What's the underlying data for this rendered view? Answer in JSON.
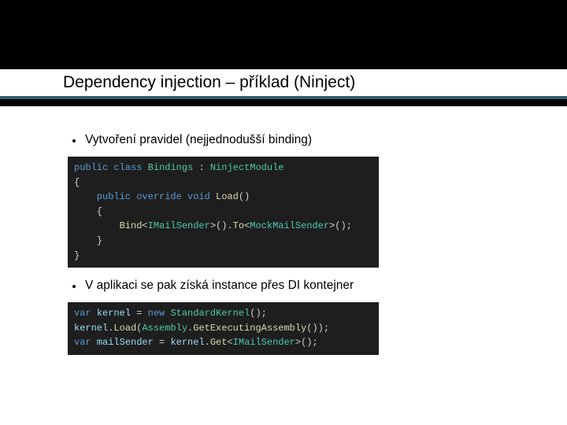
{
  "slide": {
    "title": "Dependency injection – příklad (Ninject)",
    "bullets": [
      {
        "text": "Vytvoření pravidel (nejjednodušší binding)"
      },
      {
        "text": "V aplikaci se pak získá instance přes DI kontejner"
      }
    ]
  },
  "code1": {
    "l1_public": "public",
    "l1_class": "class",
    "l1_name": "Bindings",
    "l1_colon": " : ",
    "l1_base": "NinjectModule",
    "l2": "{",
    "l3_modifiers": "    public override void ",
    "l3_method": "Load",
    "l3_paren": "()",
    "l4": "    {",
    "l5_indent": "        ",
    "l5_bind": "Bind",
    "l5_lt1": "<",
    "l5_t1": "IMailSender",
    "l5_gt1": ">().",
    "l5_to": "To",
    "l5_lt2": "<",
    "l5_t2": "MockMailSender",
    "l5_gt2": ">();",
    "l6": "    }",
    "l7": "}"
  },
  "code2": {
    "l1_var": "var",
    "l1_sp1": " ",
    "l1_kernel": "kernel",
    "l1_eq": " = ",
    "l1_new": "new",
    "l1_sp2": " ",
    "l1_type": "StandardKernel",
    "l1_end": "();",
    "l2_obj": "kernel",
    "l2_dot": ".",
    "l2_load": "Load",
    "l2_open": "(",
    "l2_asm": "Assembly",
    "l2_dot2": ".",
    "l2_gea": "GetExecutingAssembly",
    "l2_close": "());",
    "l3_var": "var",
    "l3_sp": " ",
    "l3_name": "mailSender",
    "l3_eq": " = ",
    "l3_obj": "kernel",
    "l3_dot": ".",
    "l3_get": "Get",
    "l3_lt": "<",
    "l3_t": "IMailSender",
    "l3_gt": ">();"
  }
}
